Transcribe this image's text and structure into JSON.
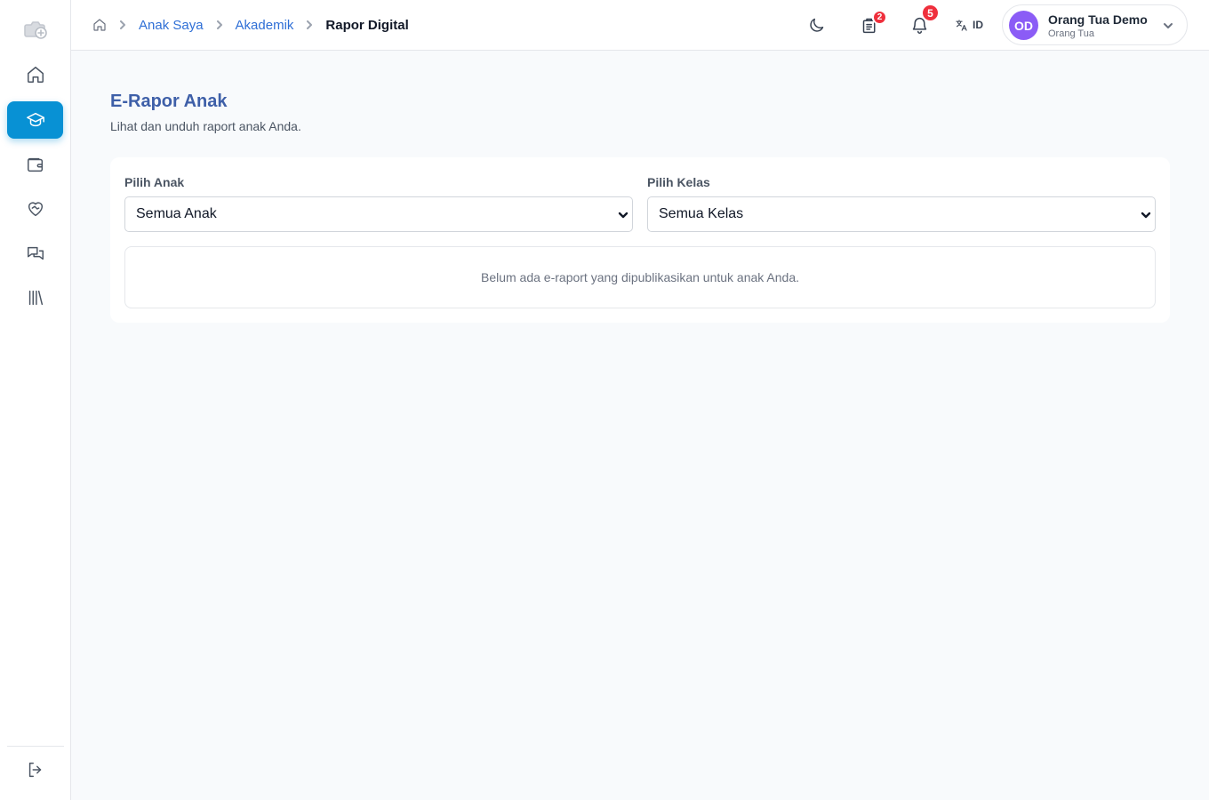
{
  "sidebar": {
    "items": [
      {
        "icon": "home-icon",
        "active": false
      },
      {
        "icon": "graduation-cap-icon",
        "active": true
      },
      {
        "icon": "wallet-icon",
        "active": false
      },
      {
        "icon": "heart-handshake-icon",
        "active": false
      },
      {
        "icon": "chat-bubbles-icon",
        "active": false
      },
      {
        "icon": "library-icon",
        "active": false
      }
    ],
    "logout_icon": "logout-icon"
  },
  "header": {
    "breadcrumb": {
      "items": [
        "Anak Saya",
        "Akademik"
      ],
      "current": "Rapor Digital"
    },
    "assignments_badge": "2",
    "notifications_badge": "5",
    "language": "ID",
    "user": {
      "initials": "OD",
      "name": "Orang Tua Demo",
      "role": "Orang Tua"
    }
  },
  "main": {
    "title": "E-Rapor Anak",
    "subtitle": "Lihat dan unduh raport anak Anda.",
    "filters": {
      "child_label": "Pilih Anak",
      "child_value": "Semua Anak",
      "class_label": "Pilih Kelas",
      "class_value": "Semua Kelas"
    },
    "empty_message": "Belum ada e-raport yang dipublikasikan untuk anak Anda."
  },
  "colors": {
    "accent": "#0891d4",
    "title": "#3e5fa8",
    "link": "#2f6fd6",
    "badge": "#ef2f3c",
    "avatar": "#8b5cf6"
  }
}
